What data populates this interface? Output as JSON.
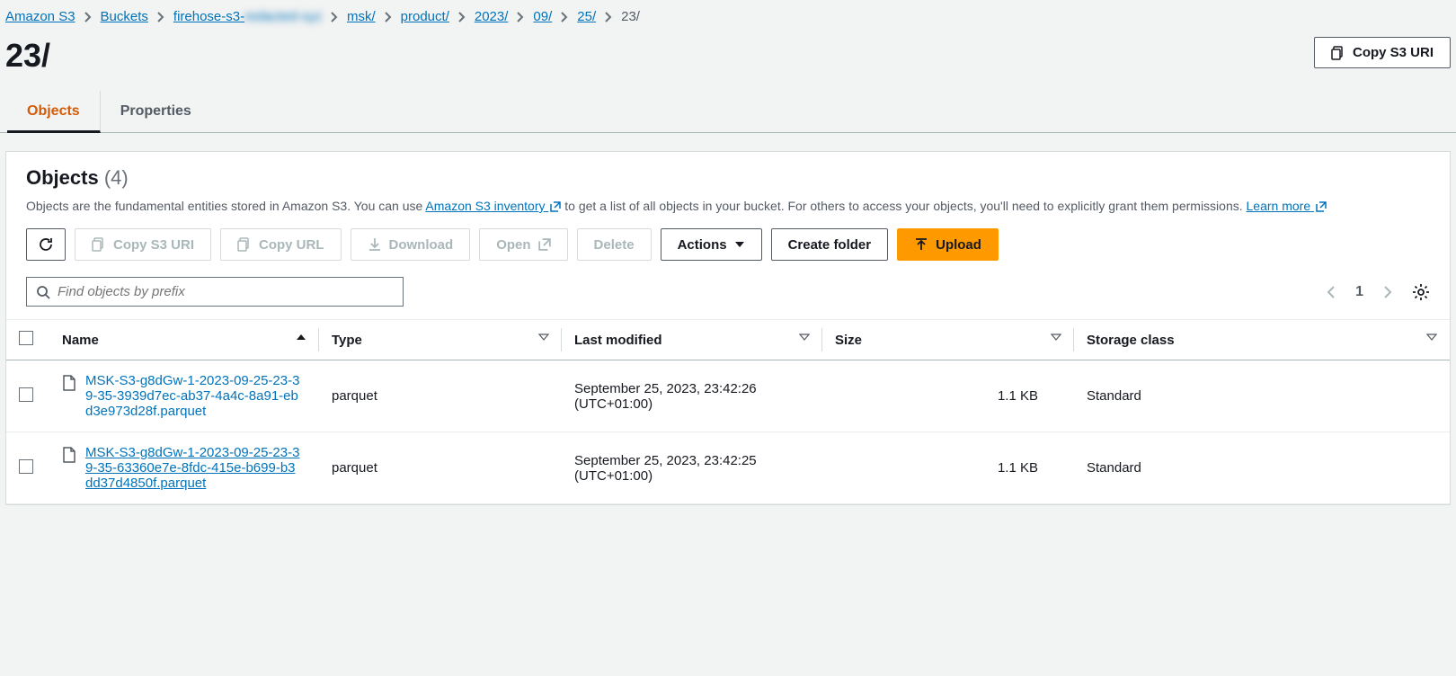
{
  "breadcrumb": {
    "items": [
      {
        "label": "Amazon S3"
      },
      {
        "label": "Buckets"
      },
      {
        "label": "firehose-s3-"
      },
      {
        "label": "msk/"
      },
      {
        "label": "product/"
      },
      {
        "label": "2023/"
      },
      {
        "label": "09/"
      },
      {
        "label": "25/"
      }
    ],
    "current": "23/"
  },
  "page_title": "23/",
  "header_actions": {
    "copy_s3_uri": "Copy S3 URI"
  },
  "tabs": [
    {
      "label": "Objects",
      "active": true
    },
    {
      "label": "Properties",
      "active": false
    }
  ],
  "objects": {
    "title": "Objects",
    "count": "(4)",
    "description_parts": {
      "p1": "Objects are the fundamental entities stored in Amazon S3. You can use ",
      "link1": "Amazon S3 inventory",
      "p2": " to get a list of all objects in your bucket. For others to access your objects, you'll need to explicitly grant them permissions. ",
      "link2": "Learn more"
    },
    "toolbar": {
      "copy_s3_uri": "Copy S3 URI",
      "copy_url": "Copy URL",
      "download": "Download",
      "open": "Open",
      "delete": "Delete",
      "actions": "Actions",
      "create_folder": "Create folder",
      "upload": "Upload"
    },
    "search_placeholder": "Find objects by prefix",
    "page_number": "1",
    "columns": {
      "name": "Name",
      "type": "Type",
      "last_modified": "Last modified",
      "size": "Size",
      "storage_class": "Storage class"
    },
    "rows": [
      {
        "name": "MSK-S3-g8dGw-1-2023-09-25-23-39-35-3939d7ec-ab37-4a4c-8a91-ebd3e973d28f.parquet",
        "type": "parquet",
        "last_modified": "September 25, 2023, 23:42:26 (UTC+01:00)",
        "size": "1.1 KB",
        "storage_class": "Standard"
      },
      {
        "name": "MSK-S3-g8dGw-1-2023-09-25-23-39-35-63360e7e-8fdc-415e-b699-b3dd37d4850f.parquet",
        "type": "parquet",
        "last_modified": "September 25, 2023, 23:42:25 (UTC+01:00)",
        "size": "1.1 KB",
        "storage_class": "Standard"
      }
    ]
  }
}
